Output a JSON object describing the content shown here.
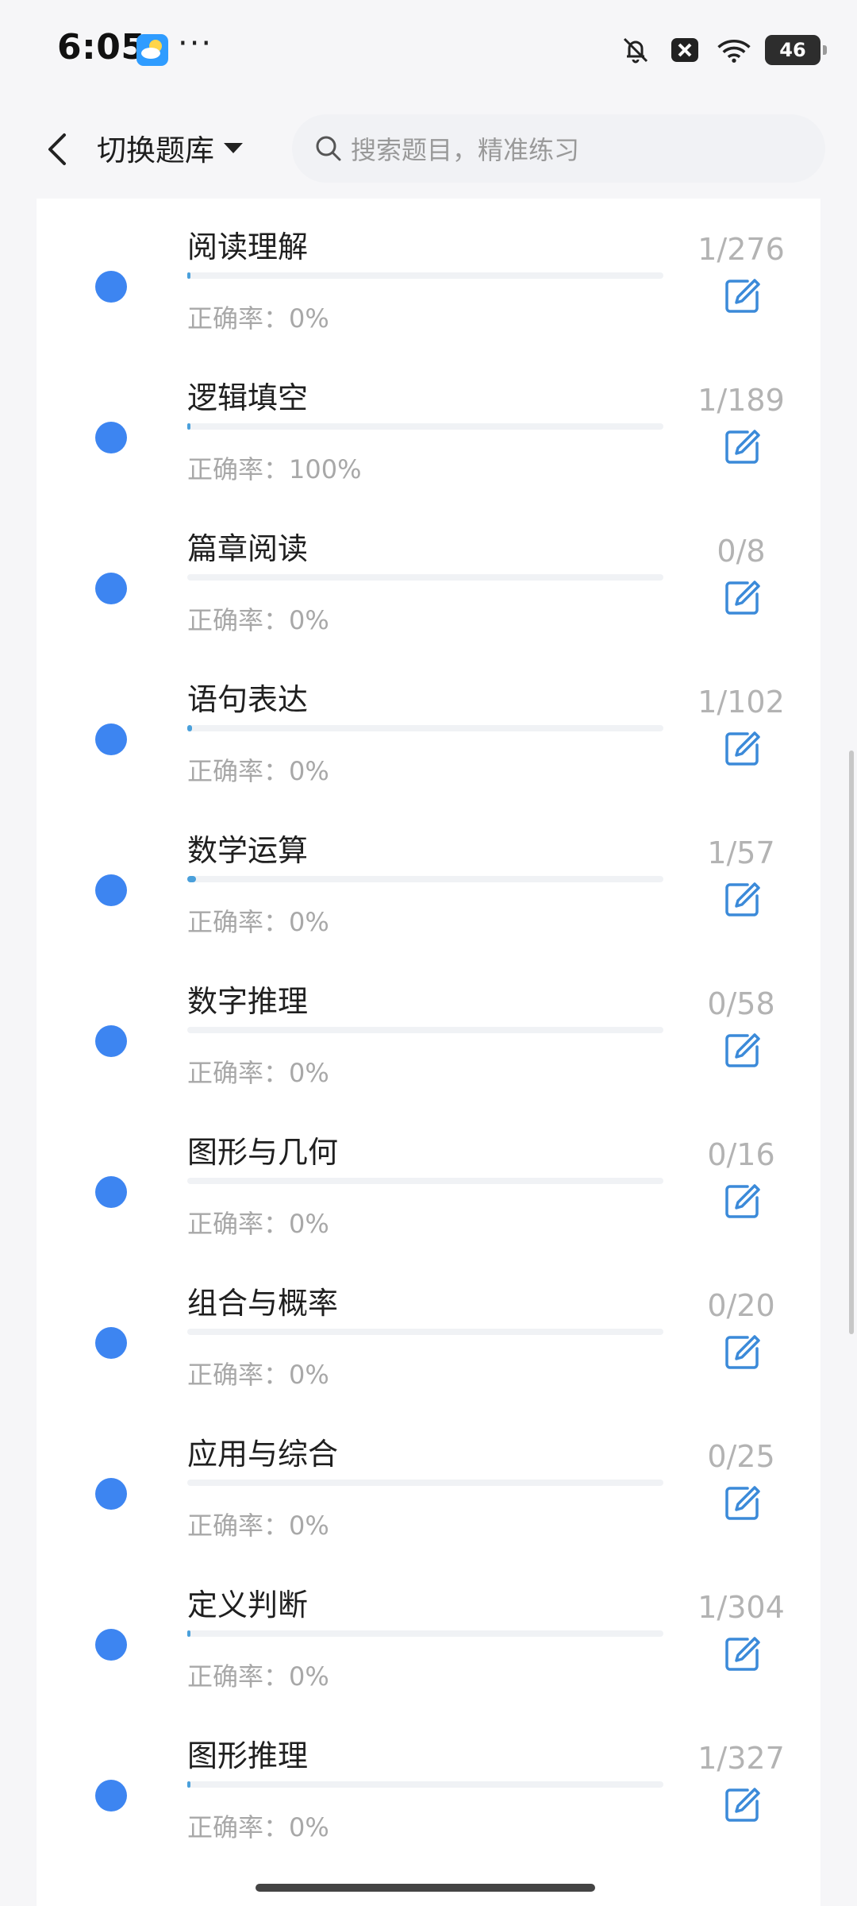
{
  "status_bar": {
    "time": "6:05",
    "more": "···",
    "battery": "46",
    "icons": [
      "weather-icon",
      "bell-off-icon",
      "x-box-icon",
      "wifi-icon",
      "battery-icon"
    ]
  },
  "header": {
    "switch_label": "切换题库",
    "search_placeholder": "搜索题目，精准练习"
  },
  "colors": {
    "dot": "#3d85f1",
    "progress": "#4aa0db",
    "edit_icon": "#3b8ad9",
    "muted_text": "#a8a8a8"
  },
  "items": [
    {
      "title": "阅读理解",
      "accuracy": "正确率：0%",
      "count": "1/276",
      "progress": 0.0036
    },
    {
      "title": "逻辑填空",
      "accuracy": "正确率：100%",
      "count": "1/189",
      "progress": 0.0053
    },
    {
      "title": "篇章阅读",
      "accuracy": "正确率：0%",
      "count": "0/8",
      "progress": 0
    },
    {
      "title": "语句表达",
      "accuracy": "正确率：0%",
      "count": "1/102",
      "progress": 0.0098
    },
    {
      "title": "数学运算",
      "accuracy": "正确率：0%",
      "count": "1/57",
      "progress": 0.0175
    },
    {
      "title": "数字推理",
      "accuracy": "正确率：0%",
      "count": "0/58",
      "progress": 0
    },
    {
      "title": "图形与几何",
      "accuracy": "正确率：0%",
      "count": "0/16",
      "progress": 0
    },
    {
      "title": "组合与概率",
      "accuracy": "正确率：0%",
      "count": "0/20",
      "progress": 0
    },
    {
      "title": "应用与综合",
      "accuracy": "正确率：0%",
      "count": "0/25",
      "progress": 0
    },
    {
      "title": "定义判断",
      "accuracy": "正确率：0%",
      "count": "1/304",
      "progress": 0.0033
    },
    {
      "title": "图形推理",
      "accuracy": "正确率：0%",
      "count": "1/327",
      "progress": 0.0031
    }
  ]
}
